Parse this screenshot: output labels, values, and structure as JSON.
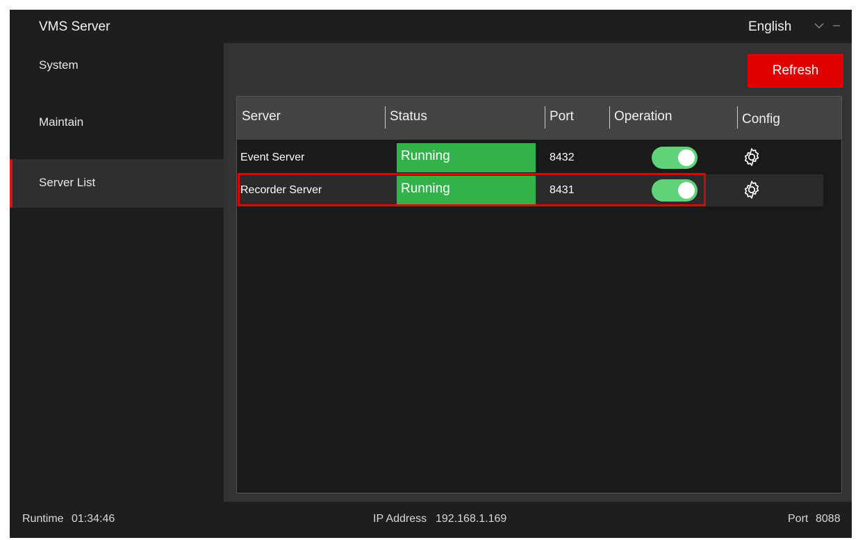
{
  "app": {
    "title": "VMS Server",
    "language": "English"
  },
  "sidebar": {
    "items": [
      {
        "label": "System"
      },
      {
        "label": "Maintain"
      },
      {
        "label": "Server List"
      }
    ]
  },
  "toolbar": {
    "refresh_label": "Refresh"
  },
  "table": {
    "headers": [
      "Server",
      "Status",
      "Port",
      "Operation",
      "Config"
    ],
    "rows": [
      {
        "server": "Event Server",
        "status": "Running",
        "port": "8432",
        "operation_on": true
      },
      {
        "server": "Recorder Server",
        "status": "Running",
        "port": "8431",
        "operation_on": true
      }
    ]
  },
  "statusbar": {
    "runtime_label": "Runtime",
    "runtime_value": "01:34:46",
    "ip_label": "IP Address",
    "ip_value": "192.168.1.169",
    "port_label": "Port",
    "port_value": "8088"
  },
  "colors": {
    "accent": "#e00000",
    "running": "#33b14a",
    "toggle_on": "#5fd27a",
    "background": "#1e1e1e"
  },
  "icons": {
    "language_dropdown": "chevron-down-icon",
    "window_minimize": "minimize-icon",
    "config": "gear-icon"
  }
}
